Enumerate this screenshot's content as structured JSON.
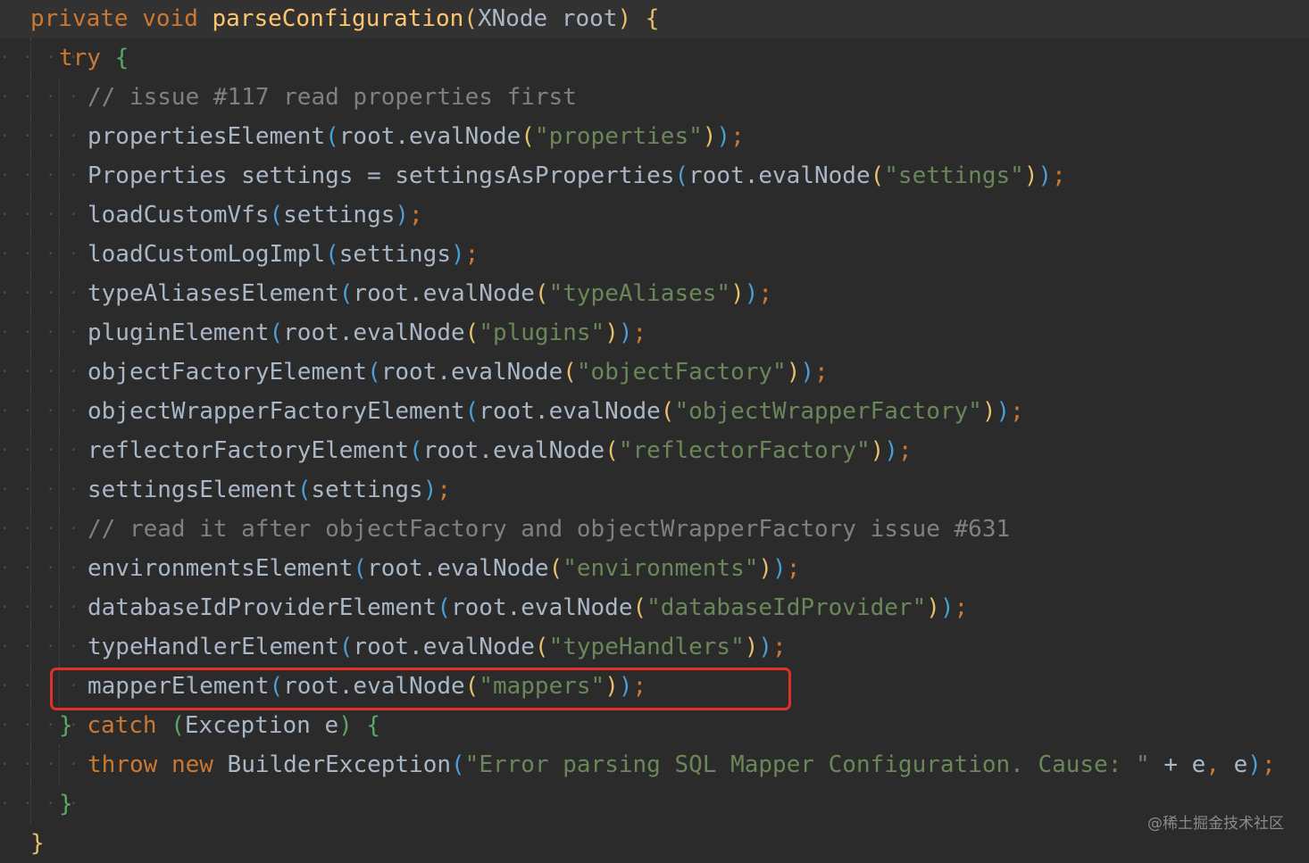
{
  "editor": {
    "lines": [
      "private void parseConfiguration(XNode root) {",
      "try {",
      "// issue #117 read properties first",
      "propertiesElement(root.evalNode(\"properties\"));",
      "Properties settings = settingsAsProperties(root.evalNode(\"settings\"));",
      "loadCustomVfs(settings);",
      "loadCustomLogImpl(settings);",
      "typeAliasesElement(root.evalNode(\"typeAliases\"));",
      "pluginElement(root.evalNode(\"plugins\"));",
      "objectFactoryElement(root.evalNode(\"objectFactory\"));",
      "objectWrapperFactoryElement(root.evalNode(\"objectWrapperFactory\"));",
      "reflectorFactoryElement(root.evalNode(\"reflectorFactory\"));",
      "settingsElement(settings);",
      "// read it after objectFactory and objectWrapperFactory issue #631",
      "environmentsElement(root.evalNode(\"environments\"));",
      "databaseIdProviderElement(root.evalNode(\"databaseIdProvider\"));",
      "typeHandlerElement(root.evalNode(\"typeHandlers\"));",
      "mapperElement(root.evalNode(\"mappers\"));",
      "} catch (Exception e) {",
      "throw new BuilderException(\"Error parsing SQL Mapper Configuration. Cause: \" + e, e);",
      "}",
      "}"
    ],
    "highlighted_line": "mapperElement(root.evalNode(\"mappers\"));"
  },
  "watermark": "@稀土掘金技术社区",
  "colors": {
    "background": "#2b2b2b",
    "keyword": "#cc7832",
    "method": "#ffc66d",
    "string": "#6a8759",
    "comment": "#808080",
    "text": "#a9b7c6",
    "highlight_box": "#e0302a"
  }
}
